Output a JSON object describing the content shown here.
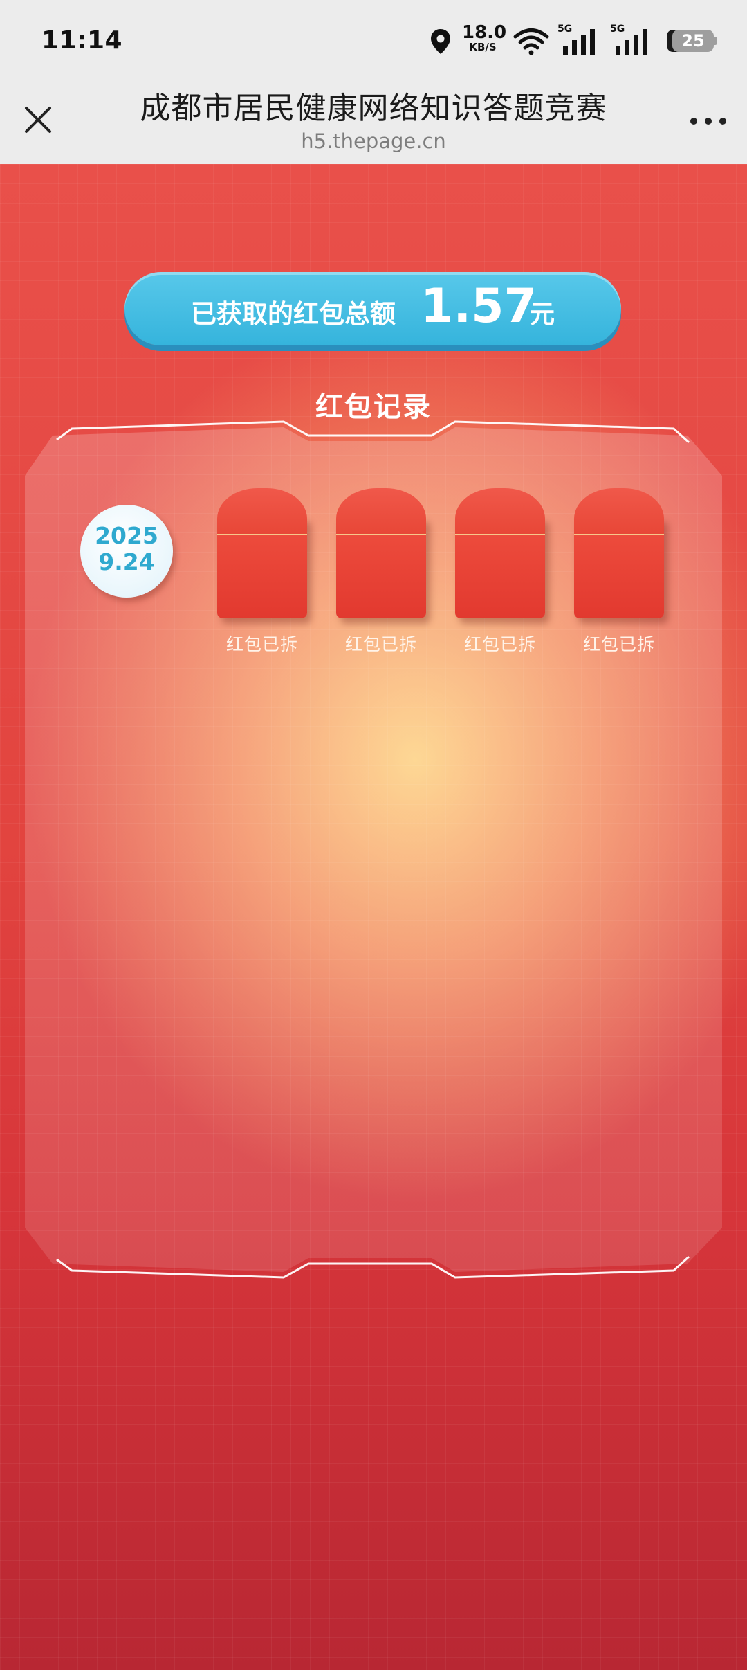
{
  "status_bar": {
    "time": "11:14",
    "net_speed_value": "18.0",
    "net_speed_unit": "KB/S",
    "signal_1_label": "5G",
    "signal_2_label": "5G",
    "battery": "25"
  },
  "title_bar": {
    "title": "成都市居民健康网络知识答题竞赛",
    "url": "h5.thepage.cn"
  },
  "summary": {
    "label": "已获取的红包总额",
    "amount": "1.57",
    "unit": "元"
  },
  "record_section": {
    "title": "红包记录",
    "date_year": "2025",
    "date_day": "9.24",
    "envelopes": [
      {
        "label": "红包已拆"
      },
      {
        "label": "红包已拆"
      },
      {
        "label": "红包已拆"
      },
      {
        "label": "红包已拆"
      }
    ]
  },
  "colors": {
    "pill_blue": "#35b4dc",
    "envelope_red": "#e2392f",
    "background_red": "#d6353a",
    "glow_yellow": "#ffd782"
  }
}
